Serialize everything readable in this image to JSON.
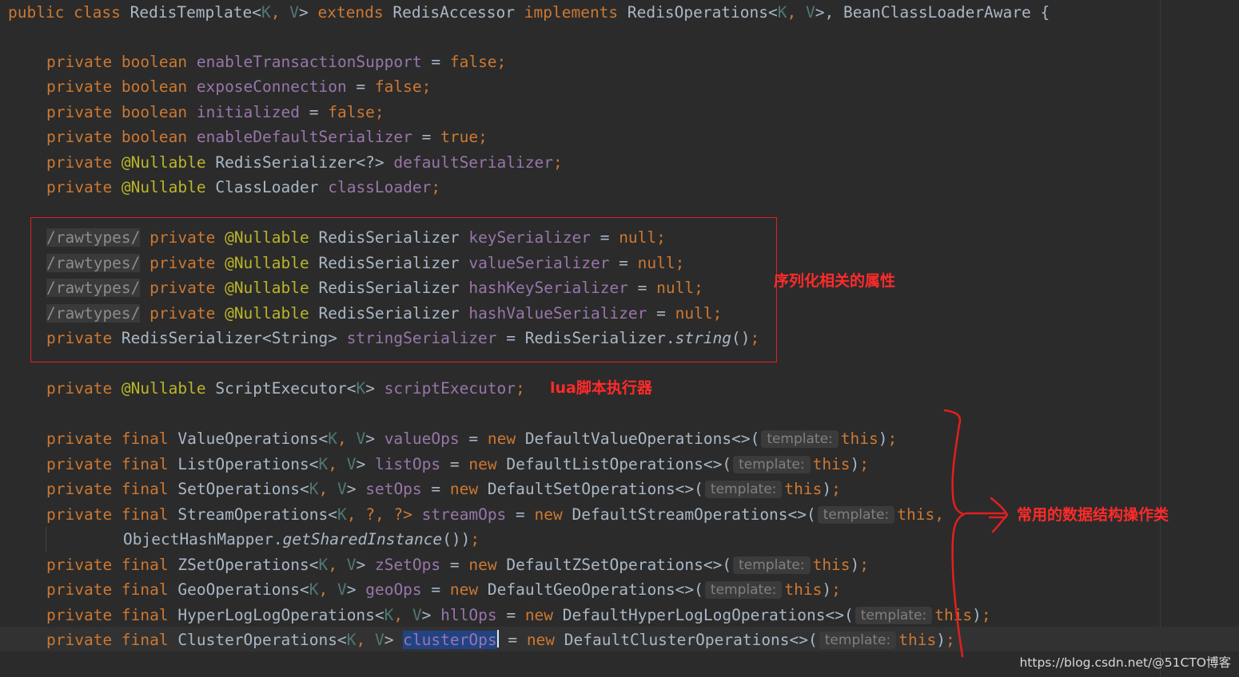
{
  "code": {
    "l0": {
      "a": "public class ",
      "b": "RedisTemplate<",
      "c": "K",
      ",": ", ",
      "d": "V",
      "e": "> ",
      "f": "extends ",
      "g": "RedisAccessor ",
      "h": "implements ",
      "i": "RedisOperations<",
      "j": "K",
      "k": ", ",
      "l": "V",
      "m": ">, BeanClassLoaderAware {"
    },
    "l1": {
      "a": "private ",
      "b": "boolean ",
      "c": "enableTransactionSupport",
      " ": " = ",
      "d": "false",
      ";": ";"
    },
    "l2": {
      "a": "private ",
      "b": "boolean ",
      "c": "exposeConnection",
      " ": " = ",
      "d": "false",
      ";": ";"
    },
    "l3": {
      "a": "private ",
      "b": "boolean ",
      "c": "initialized",
      " ": " = ",
      "d": "false",
      ";": ";"
    },
    "l4": {
      "a": "private ",
      "b": "boolean ",
      "c": "enableDefaultSerializer",
      " ": " = ",
      "d": "true",
      ";": ";"
    },
    "l5": {
      "a": "private ",
      "b": "@Nullable ",
      "c": "RedisSerializer<?> ",
      "d": "defaultSerializer",
      ";": ";"
    },
    "l6": {
      "a": "private ",
      "b": "@Nullable ",
      "c": "ClassLoader ",
      "d": "classLoader",
      ";": ";"
    },
    "l7": {
      "r": "/rawtypes/",
      "a": " private ",
      "b": "@Nullable ",
      "c": "RedisSerializer ",
      "d": "keySerializer",
      " ": " = ",
      "n": "null",
      ";": ";"
    },
    "l8": {
      "r": "/rawtypes/",
      "a": " private ",
      "b": "@Nullable ",
      "c": "RedisSerializer ",
      "d": "valueSerializer",
      " ": " = ",
      "n": "null",
      ";": ";"
    },
    "l9": {
      "r": "/rawtypes/",
      "a": " private ",
      "b": "@Nullable ",
      "c": "RedisSerializer ",
      "d": "hashKeySerializer",
      " ": " = ",
      "n": "null",
      ";": ";"
    },
    "l10": {
      "r": "/rawtypes/",
      "a": " private ",
      "b": "@Nullable ",
      "c": "RedisSerializer ",
      "d": "hashValueSerializer",
      " ": " = ",
      "n": "null",
      ";": ";"
    },
    "l11": {
      "a": "private ",
      "c": "RedisSerializer<String> ",
      "d": "stringSerializer",
      " ": " = RedisSerializer.",
      "s": "string",
      "p": "()",
      ";": ";"
    },
    "l12": {
      "a": "private ",
      "b": "@Nullable ",
      "c": "ScriptExecutor<",
      "k": "K",
      "e": "> ",
      "d": "scriptExecutor",
      ";": ";"
    },
    "l13": {
      "a": "private final ",
      "c": "ValueOperations<",
      "k": "K",
      ",": ", ",
      "v": "V",
      "e": "> ",
      "d": "valueOps",
      " ": " = ",
      "w": "new ",
      "x": "DefaultValueOperations<>(",
      "h": "template:",
      "t": "this",
      "z": ")",
      ";": ";"
    },
    "l14": {
      "a": "private final ",
      "c": "ListOperations<",
      "k": "K",
      ",": ", ",
      "v": "V",
      "e": "> ",
      "d": "listOps",
      " ": " = ",
      "w": "new ",
      "x": "DefaultListOperations<>(",
      "h": "template:",
      "t": "this",
      "z": ")",
      ";": ";"
    },
    "l15": {
      "a": "private final ",
      "c": "SetOperations<",
      "k": "K",
      ",": ", ",
      "v": "V",
      "e": "> ",
      "d": "setOps",
      " ": " = ",
      "w": "new ",
      "x": "DefaultSetOperations<>(",
      "h": "template:",
      "t": "this",
      "z": ")",
      ";": ";"
    },
    "l16": {
      "a": "private final ",
      "c": "StreamOperations<",
      "k": "K",
      ",": ", ?, ?> ",
      "d": "streamOps",
      " ": " = ",
      "w": "new ",
      "x": "DefaultStreamOperations<>(",
      "h": "template:",
      "t": "this",
      ",,": ","
    },
    "l17": {
      "c": "ObjectHashMapper.",
      "s": "getSharedInstance",
      "p": "())",
      ";": ";"
    },
    "l18": {
      "a": "private final ",
      "c": "ZSetOperations<",
      "k": "K",
      ",": ", ",
      "v": "V",
      "e": "> ",
      "d": "zSetOps",
      " ": " = ",
      "w": "new ",
      "x": "DefaultZSetOperations<>(",
      "h": "template:",
      "t": "this",
      "z": ")",
      ";": ";"
    },
    "l19": {
      "a": "private final ",
      "c": "GeoOperations<",
      "k": "K",
      ",": ", ",
      "v": "V",
      "e": "> ",
      "d": "geoOps",
      " ": " = ",
      "w": "new ",
      "x": "DefaultGeoOperations<>(",
      "h": "template:",
      "t": "this",
      "z": ")",
      ";": ";"
    },
    "l20": {
      "a": "private final ",
      "c": "HyperLogLogOperations<",
      "k": "K",
      ",": ", ",
      "v": "V",
      "e": "> ",
      "d": "hllOps",
      " ": " = ",
      "w": "new ",
      "x": "DefaultHyperLogLogOperations<>(",
      "h": "template:",
      "t": "this",
      "z": ")",
      ";": ";"
    },
    "l21": {
      "a": "private final ",
      "c": "ClusterOperations<",
      "k": "K",
      ",": ", ",
      "v": "V",
      "e": "> ",
      "d": "clusterOps",
      " ": " = ",
      "w": "new ",
      "x": "DefaultClusterOperations<>(",
      "h": "template:",
      "t": "this",
      "z": ")",
      ";": ";"
    }
  },
  "annotations": {
    "serializers": "序列化相关的属性",
    "lua": "lua脚本执行器",
    "ops": "常用的数据结构操作类"
  },
  "watermark": "https://blog.csdn.net/@51CTO博客",
  "colors": {
    "background": "#2b2b2b",
    "keyword": "#cc7832",
    "annotation": "#bbb529",
    "field": "#9876aa",
    "text": "#a9b7c6",
    "type_param": "#507874",
    "selection": "#214283",
    "markup_red": "#e02020"
  }
}
